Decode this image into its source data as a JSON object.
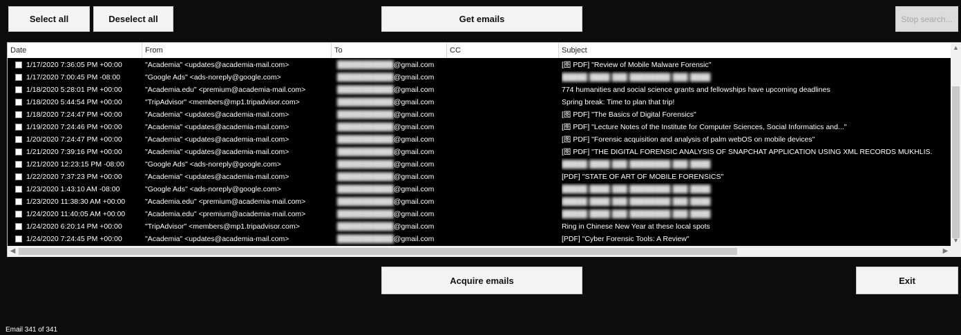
{
  "toolbar": {
    "select_all": "Select all",
    "deselect_all": "Deselect all",
    "get_emails": "Get emails",
    "stop_search": "Stop search..."
  },
  "grid": {
    "columns": [
      "Date",
      "From",
      "To",
      "CC",
      "Subject"
    ],
    "rows": [
      {
        "date": "1/17/2020 7:36:05 PM +00:00",
        "from": "\"Academia\" <updates@academia-mail.com>",
        "to": "@gmail.com",
        "cc": "",
        "subject": "[图 PDF] \"Review of Mobile Malware Forensic\""
      },
      {
        "date": "1/17/2020 7:00:45 PM -08:00",
        "from": "\"Google Ads\" <ads-noreply@google.com>",
        "to": "@gmail.com",
        "cc": "",
        "subject": ""
      },
      {
        "date": "1/18/2020 5:28:01 PM +00:00",
        "from": "\"Academia.edu\" <premium@academia-mail.com>",
        "to": "@gmail.com",
        "cc": "",
        "subject": "774 humanities and social science grants and fellowships have upcoming deadlines"
      },
      {
        "date": "1/18/2020 5:44:54 PM +00:00",
        "from": "\"TripAdvisor\" <members@mp1.tripadvisor.com>",
        "to": "@gmail.com",
        "cc": "",
        "subject": "Spring break: Time to plan that trip!"
      },
      {
        "date": "1/18/2020 7:24:47 PM +00:00",
        "from": "\"Academia\" <updates@academia-mail.com>",
        "to": "@gmail.com",
        "cc": "",
        "subject": "[图 PDF] \"The Basics of Digital Forensics\""
      },
      {
        "date": "1/19/2020 7:24:46 PM +00:00",
        "from": "\"Academia\" <updates@academia-mail.com>",
        "to": "@gmail.com",
        "cc": "",
        "subject": "[图 PDF] \"Lecture Notes of the Institute for Computer Sciences, Social Informatics and...\""
      },
      {
        "date": "1/20/2020 7:24:47 PM +00:00",
        "from": "\"Academia\" <updates@academia-mail.com>",
        "to": "@gmail.com",
        "cc": "",
        "subject": "[图 PDF] \"Forensic acquisition and analysis of palm webOS on mobile devices\""
      },
      {
        "date": "1/21/2020 7:39:16 PM +00:00",
        "from": "\"Academia\" <updates@academia-mail.com>",
        "to": "@gmail.com",
        "cc": "",
        "subject": "[图 PDF] \"THE DIGITAL FORENSIC ANALYSIS OF SNAPCHAT APPLICATION USING XML RECORDS MUKHLIS."
      },
      {
        "date": "1/21/2020 12:23:15 PM -08:00",
        "from": "\"Google Ads\" <ads-noreply@google.com>",
        "to": "@gmail.com",
        "cc": "",
        "subject": ""
      },
      {
        "date": "1/22/2020 7:37:23 PM +00:00",
        "from": "\"Academia\" <updates@academia-mail.com>",
        "to": "@gmail.com",
        "cc": "",
        "subject": "[PDF] \"STATE OF ART OF MOBILE FORENSICS\""
      },
      {
        "date": "1/23/2020 1:43:10 AM -08:00",
        "from": "\"Google Ads\" <ads-noreply@google.com>",
        "to": "@gmail.com",
        "cc": "",
        "subject": ""
      },
      {
        "date": "1/23/2020 11:38:30 AM +00:00",
        "from": "\"Academia.edu\" <premium@academia-mail.com>",
        "to": "@gmail.com",
        "cc": "",
        "subject": ""
      },
      {
        "date": "1/24/2020 11:40:05 AM +00:00",
        "from": "\"Academia.edu\" <premium@academia-mail.com>",
        "to": "@gmail.com",
        "cc": "",
        "subject": ""
      },
      {
        "date": "1/24/2020 6:20:14 PM +00:00",
        "from": "\"TripAdvisor\" <members@mp1.tripadvisor.com>",
        "to": "@gmail.com",
        "cc": "",
        "subject": "Ring in Chinese New Year at these local spots"
      },
      {
        "date": "1/24/2020 7:24:45 PM +00:00",
        "from": "\"Academia\" <updates@academia-mail.com>",
        "to": "@gmail.com",
        "cc": "",
        "subject": "[PDF] \"Cyber Forensic Tools: A Review\""
      }
    ]
  },
  "actions": {
    "acquire_emails": "Acquire emails",
    "exit": "Exit"
  },
  "status": {
    "text": "Email 341 of 341"
  },
  "scroll_icons": {
    "up": "chevron-up-icon",
    "down": "chevron-down-icon",
    "left": "chevron-left-icon",
    "right": "chevron-right-icon"
  }
}
